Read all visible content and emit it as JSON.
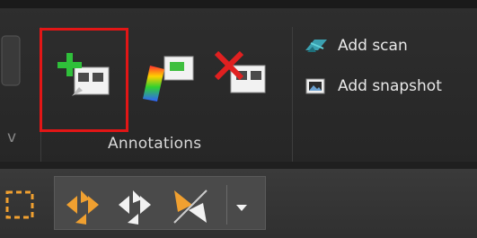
{
  "ribbon": {
    "group_label": "Annotations",
    "left_partial_glyph": "v",
    "tools": [
      {
        "name": "add-annotation",
        "icon": "plus-annotation-icon",
        "highlighted": true
      },
      {
        "name": "color-annotation",
        "icon": "color-annotation-icon"
      },
      {
        "name": "delete-annotation",
        "icon": "delete-annotation-icon"
      }
    ],
    "list_buttons": [
      {
        "label": "Add scan",
        "icon": "scan-icon"
      },
      {
        "label": "Add snapshot",
        "icon": "snapshot-icon"
      }
    ]
  },
  "toolbar": {
    "items": [
      "selection-box-icon",
      "orange-collapse-arrows-icon",
      "white-collapse-arrows-icon",
      "half-orange-arrows-icon",
      "dropdown-arrow-icon"
    ]
  },
  "colors": {
    "highlight": "#e21616",
    "accent_orange": "#f0a030",
    "green_plus": "#2fbf3a",
    "red_x": "#e02020"
  }
}
